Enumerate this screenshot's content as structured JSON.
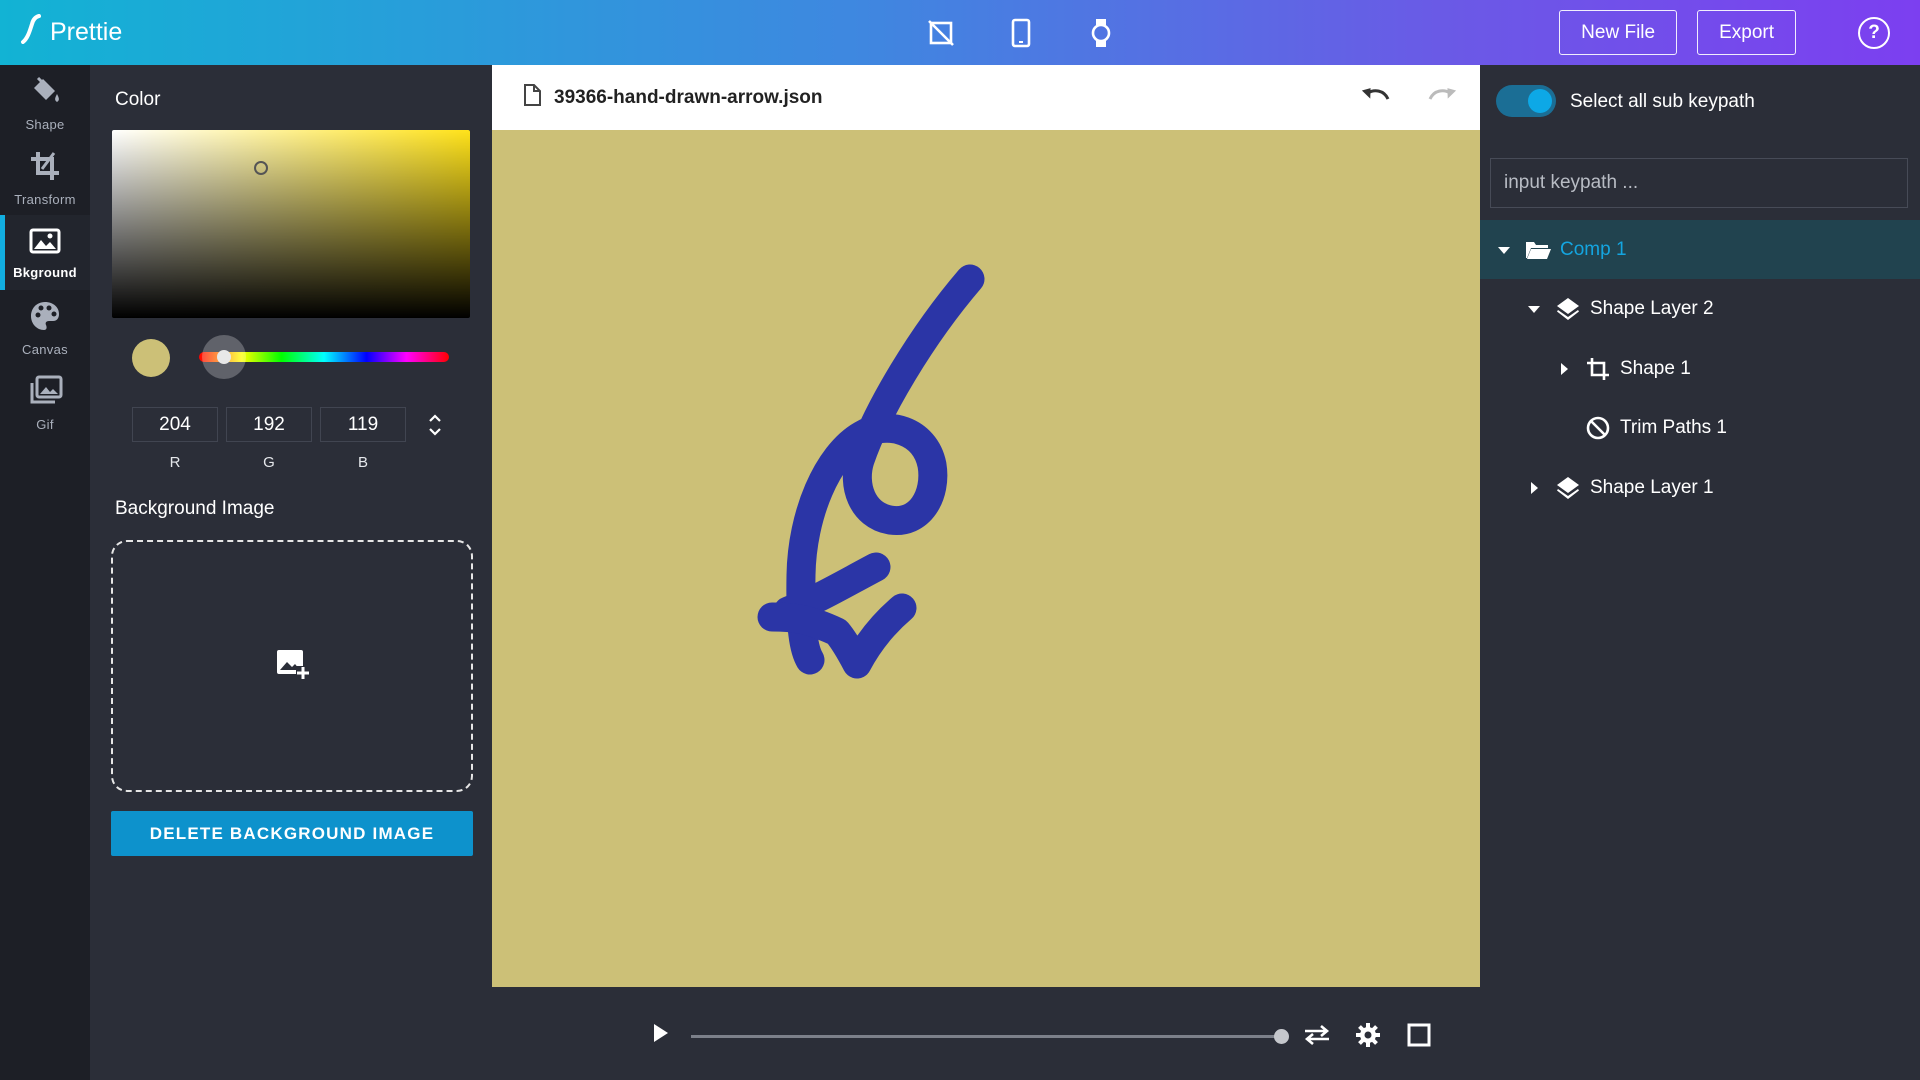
{
  "app": {
    "name": "Prettie"
  },
  "topbar": {
    "device_icons": [
      "no-screen-icon",
      "phone-icon",
      "watch-icon"
    ],
    "new_file_label": "New File",
    "export_label": "Export",
    "help_label": "?"
  },
  "leftnav": {
    "items": [
      {
        "label": "Shape",
        "icon": "paint-bucket-icon",
        "active": false
      },
      {
        "label": "Transform",
        "icon": "crop-icon",
        "active": false
      },
      {
        "label": "Bkground",
        "icon": "image-icon",
        "active": true
      },
      {
        "label": "Canvas",
        "icon": "palette-icon",
        "active": false
      },
      {
        "label": "Gif",
        "icon": "gif-images-icon",
        "active": false
      }
    ]
  },
  "color_panel": {
    "title": "Color",
    "current_color": "#ccc077",
    "hue_color": "#ffe21a",
    "r": "204",
    "g": "192",
    "b": "119",
    "r_label": "R",
    "g_label": "G",
    "b_label": "B"
  },
  "background_image": {
    "title": "Background Image",
    "delete_label": "DELETE BACKGROUND IMAGE"
  },
  "file": {
    "name": "39366-hand-drawn-arrow.json"
  },
  "canvas": {
    "background": "#ccc077",
    "stroke_color": "#2b35a6"
  },
  "player": {
    "progress": 1.0
  },
  "keypath": {
    "select_all_label": "Select all sub keypath",
    "select_all_on": true,
    "input_placeholder": "input keypath ..."
  },
  "layer_tree": [
    {
      "label": "Comp 1",
      "icon": "folder-open-icon",
      "caret": "down",
      "selected": true,
      "depth": 0
    },
    {
      "label": "Shape Layer 2",
      "icon": "layers-icon",
      "caret": "down",
      "selected": false,
      "depth": 1
    },
    {
      "label": "Shape 1",
      "icon": "crop-icon",
      "caret": "right",
      "selected": false,
      "depth": 2
    },
    {
      "label": "Trim Paths 1",
      "icon": "block-icon",
      "caret": "none",
      "selected": false,
      "depth": 2
    },
    {
      "label": "Shape Layer 1",
      "icon": "layers-icon",
      "caret": "right",
      "selected": false,
      "depth": 1
    }
  ],
  "colors": {
    "accent": "#0d92cc",
    "selected_row": "#21434f",
    "selected_text": "#14a5e0"
  }
}
